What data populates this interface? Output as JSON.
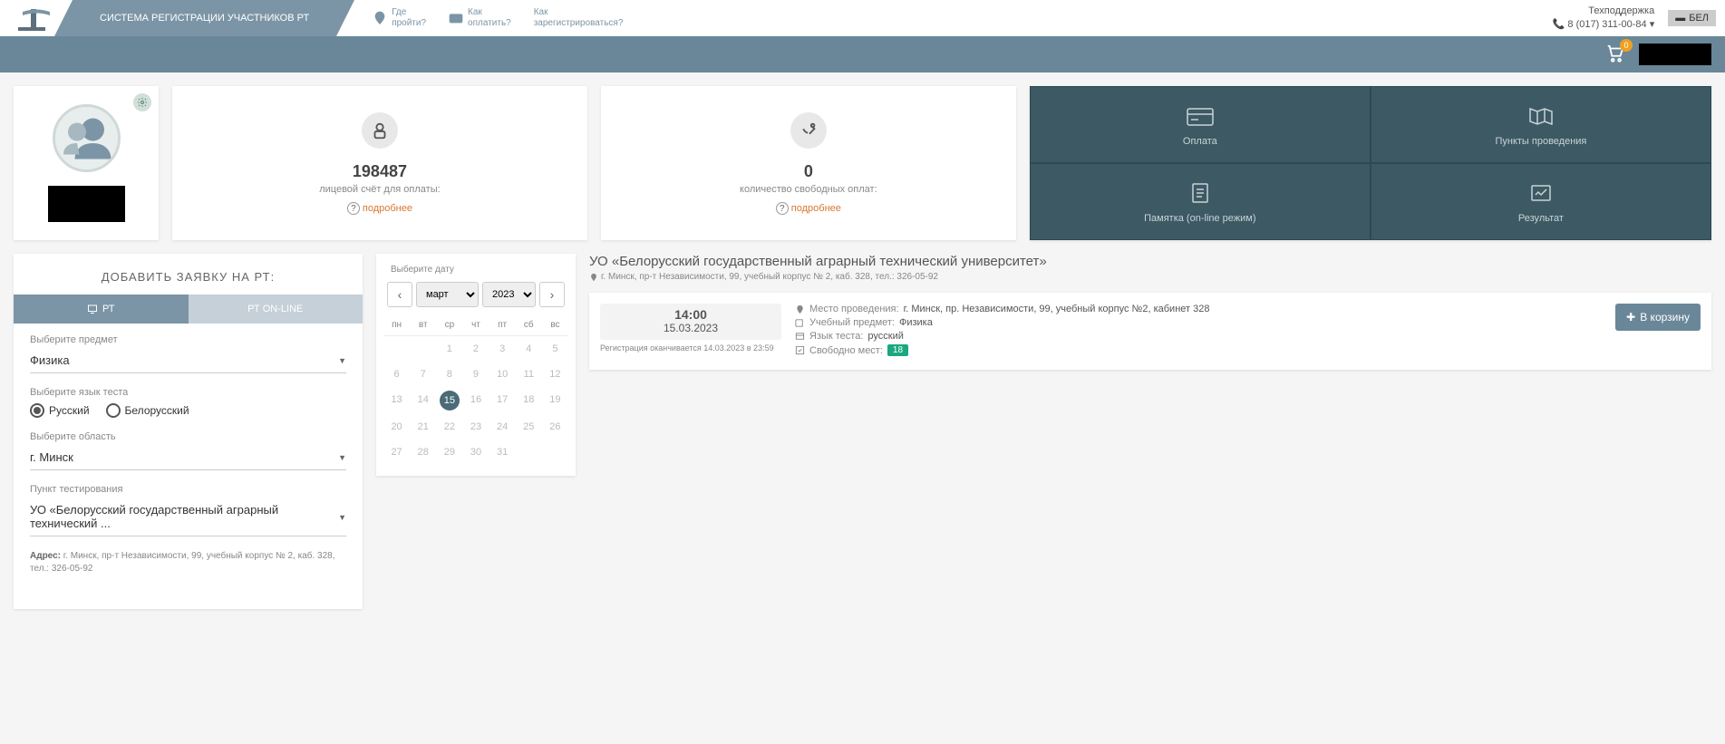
{
  "header": {
    "system_title": "СИСТЕМА РЕГИСТРАЦИИ УЧАСТНИКОВ РТ",
    "nav": {
      "where_label1": "Где",
      "where_label2": "пройти?",
      "pay_label1": "Как",
      "pay_label2": "оплатить?",
      "reg_label1": "Как",
      "reg_label2": "зарегистрироваться?"
    },
    "support_label": "Техподдержка",
    "support_phone": "8 (017) 311-00-84",
    "lang": "БЕЛ",
    "cart_count": "0"
  },
  "stats": {
    "account_value": "198487",
    "account_label": "лицевой счёт для оплаты:",
    "free_value": "0",
    "free_label": "количество свободных оплат:",
    "more": "подробнее"
  },
  "tiles": {
    "payment": "Оплата",
    "points": "Пункты проведения",
    "memo": "Памятка (on-line режим)",
    "result": "Результат"
  },
  "form": {
    "title": "ДОБАВИТЬ ЗАЯВКУ НА РТ:",
    "tab_rt": "РТ",
    "tab_online": "РТ ON-LINE",
    "subject_label": "Выберите предмет",
    "subject_value": "Физика",
    "lang_label": "Выберите язык теста",
    "lang_ru": "Русский",
    "lang_be": "Белорусский",
    "region_label": "Выберите область",
    "region_value": "г. Минск",
    "point_label": "Пункт тестирования",
    "point_value": "УО «Белорусский государственный аграрный технический ...",
    "address_label": "Адрес: ",
    "address_value": "г. Минск, пр-т Независимости, 99, учебный корпус № 2, каб. 328, тел.: 326-05-92"
  },
  "calendar": {
    "title": "Выберите дату",
    "month": "март",
    "year": "2023",
    "days": [
      "пн",
      "вт",
      "ср",
      "чт",
      "пт",
      "сб",
      "вс"
    ],
    "weeks": [
      [
        "",
        "",
        "1",
        "2",
        "3",
        "4",
        "5"
      ],
      [
        "6",
        "7",
        "8",
        "9",
        "10",
        "11",
        "12"
      ],
      [
        "13",
        "14",
        "15",
        "16",
        "17",
        "18",
        "19"
      ],
      [
        "20",
        "21",
        "22",
        "23",
        "24",
        "25",
        "26"
      ],
      [
        "27",
        "28",
        "29",
        "30",
        "31",
        "",
        ""
      ]
    ],
    "selected": "15"
  },
  "venue": {
    "title": "УО «Белорусский государственный аграрный технический университет»",
    "address": "г. Минск, пр-т Независимости, 99, учебный корпус № 2, каб. 328, тел.: 326-05-92"
  },
  "slot": {
    "time": "14:00",
    "date": "15.03.2023",
    "reg_ends": "Регистрация оканчивается 14.03.2023 в 23:59",
    "loc_label": "Место проведения:",
    "loc_value": "г. Минск, пр. Независимости, 99, учебный корпус №2, кабинет 328",
    "subj_label": "Учебный предмет:",
    "subj_value": "Физика",
    "lang_label": "Язык теста:",
    "lang_value": "русский",
    "free_label": "Свободно мест:",
    "free_value": "18",
    "cart_btn": "В корзину"
  }
}
